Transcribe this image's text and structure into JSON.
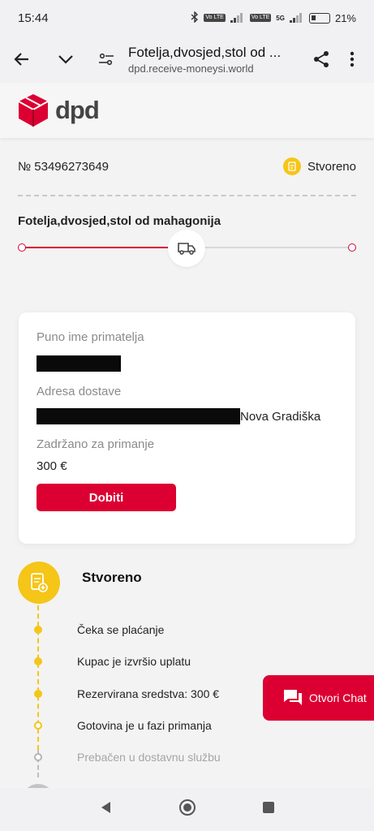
{
  "status_bar": {
    "time": "15:44",
    "battery": "21%",
    "network_a": "Vo LTE",
    "network_b": "Vo LTE",
    "network_type": "5G"
  },
  "browser": {
    "title": "Fotelja,dvosjed,stol od ...",
    "domain": "dpd.receive-moneysi.world"
  },
  "brand": {
    "name": "dpd",
    "accent": "#dc0032"
  },
  "shipment": {
    "tracking_number": "№ 53496273649",
    "status": "Stvoreno",
    "product": "Fotelja,dvosjed,stol od mahagonija",
    "progress_icon": "truck-icon"
  },
  "card": {
    "recipient_label": "Puno ime primatelja",
    "address_label": "Adresa dostave",
    "address_suffix": "Nova Gradiška",
    "held_label": "Zadržano za primanje",
    "held_value": "300 €",
    "button_label": "Dobiti"
  },
  "timeline": {
    "title": "Stvoreno",
    "steps": [
      {
        "label": "Čeka se plaćanje",
        "state": "done"
      },
      {
        "label": "Kupac je izvršio uplatu",
        "state": "done"
      },
      {
        "label": "Rezervirana sredstva: 300 €",
        "state": "done"
      },
      {
        "label": "Gotovina je u fazi primanja",
        "state": "current"
      },
      {
        "label": "Prebačen u dostavnu službu",
        "state": "pending"
      }
    ]
  },
  "chat": {
    "label": "Otvori Chat"
  },
  "colors": {
    "accent": "#dc0032",
    "yellow": "#f5c518"
  }
}
